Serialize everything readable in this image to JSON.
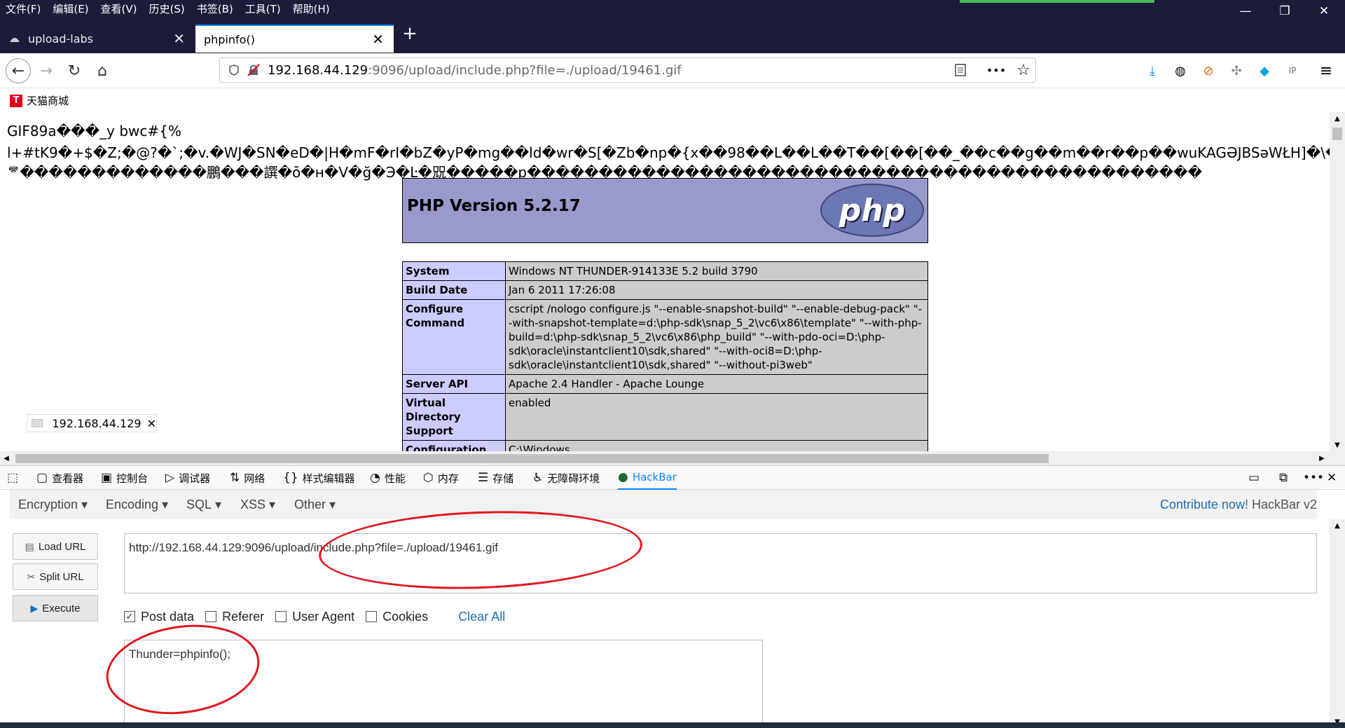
{
  "menubar": {
    "items": [
      "文件(F)",
      "编辑(E)",
      "查看(V)",
      "历史(S)",
      "书签(B)",
      "工具(T)",
      "帮助(H)"
    ]
  },
  "window_controls": {
    "minimize": "—",
    "restore": "❐",
    "close": "✕"
  },
  "tabs": [
    {
      "label": "upload-labs",
      "close": "✕"
    },
    {
      "label": "phpinfo()",
      "close": "✕"
    }
  ],
  "newtab": "+",
  "navbar": {
    "back": "←",
    "forward": "→",
    "reload": "↻",
    "home": "⌂",
    "url_host": "192.168.44.129",
    "url_rest": ":9096/upload/include.php?file=./upload/19461.gif",
    "more": "•••",
    "star": "☆"
  },
  "bookmarks": [
    {
      "icon": "T",
      "label": "天猫商城"
    }
  ],
  "page": {
    "garbage_lines": [
      "GIF89a���_y bwc#{%",
      "l+#tK9�+$�Z;�@?�`;�v.�WJ�SN�eD�|H�mF�rI�bZ�yP�mg��ld�wr�S[�Zb�np�{x��98��L��L��T��[��[��_��c��g��m��r��p��wuKAGƏJBSəWŁH]�\\�~ㄷe⿈mṫ's�c",
      "ᄛ�������������鵬���譔�ō�н�V�ğ�Э�Ŀ�㒭�����р�����������������������������������������������"
    ],
    "php_version": "PHP Version 5.2.17",
    "php_logo": "php",
    "info_rows": [
      {
        "key": "System",
        "value": "Windows NT THUNDER-914133E 5.2 build 3790"
      },
      {
        "key": "Build Date",
        "value": "Jan 6 2011 17:26:08"
      },
      {
        "key": "Configure Command",
        "value": "cscript /nologo configure.js \"--enable-snapshot-build\" \"--enable-debug-pack\" \"--with-snapshot-template=d:\\php-sdk\\snap_5_2\\vc6\\x86\\template\" \"--with-php-build=d:\\php-sdk\\snap_5_2\\vc6\\x86\\php_build\" \"--with-pdo-oci=D:\\php-sdk\\oracle\\instantclient10\\sdk,shared\" \"--with-oci8=D:\\php-sdk\\oracle\\instantclient10\\sdk,shared\" \"--without-pi3web\""
      },
      {
        "key": "Server API",
        "value": "Apache 2.4 Handler - Apache Lounge"
      },
      {
        "key": "Virtual Directory Support",
        "value": "enabled"
      },
      {
        "key": "Configuration File",
        "value": "C:\\Windows"
      }
    ],
    "tooltip": "192.168.44.129"
  },
  "devtools": {
    "tabs": [
      "查看器",
      "控制台",
      "调试器",
      "网络",
      "样式编辑器",
      "性能",
      "内存",
      "存储",
      "无障碍环境",
      "HackBar"
    ],
    "hackbar": {
      "menus": [
        "Encryption",
        "Encoding",
        "SQL",
        "XSS",
        "Other"
      ],
      "contribute_link": "Contribute now!",
      "version": "HackBar v2",
      "buttons": [
        "Load URL",
        "Split URL",
        "Execute"
      ],
      "url_value": "http://192.168.44.129:9096/upload/include.php?file=./upload/19461.gif",
      "checkboxes": [
        {
          "label": "Post data",
          "checked": true
        },
        {
          "label": "Referer",
          "checked": false
        },
        {
          "label": "User Agent",
          "checked": false
        },
        {
          "label": "Cookies",
          "checked": false
        }
      ],
      "clear_all": "Clear All",
      "post_value": "Thunder=phpinfo();"
    }
  },
  "colors": {
    "chrome": "#1c1b39",
    "php_header": "#9999cc",
    "annotation": "#e3141c",
    "link": "#1b6fb3"
  }
}
